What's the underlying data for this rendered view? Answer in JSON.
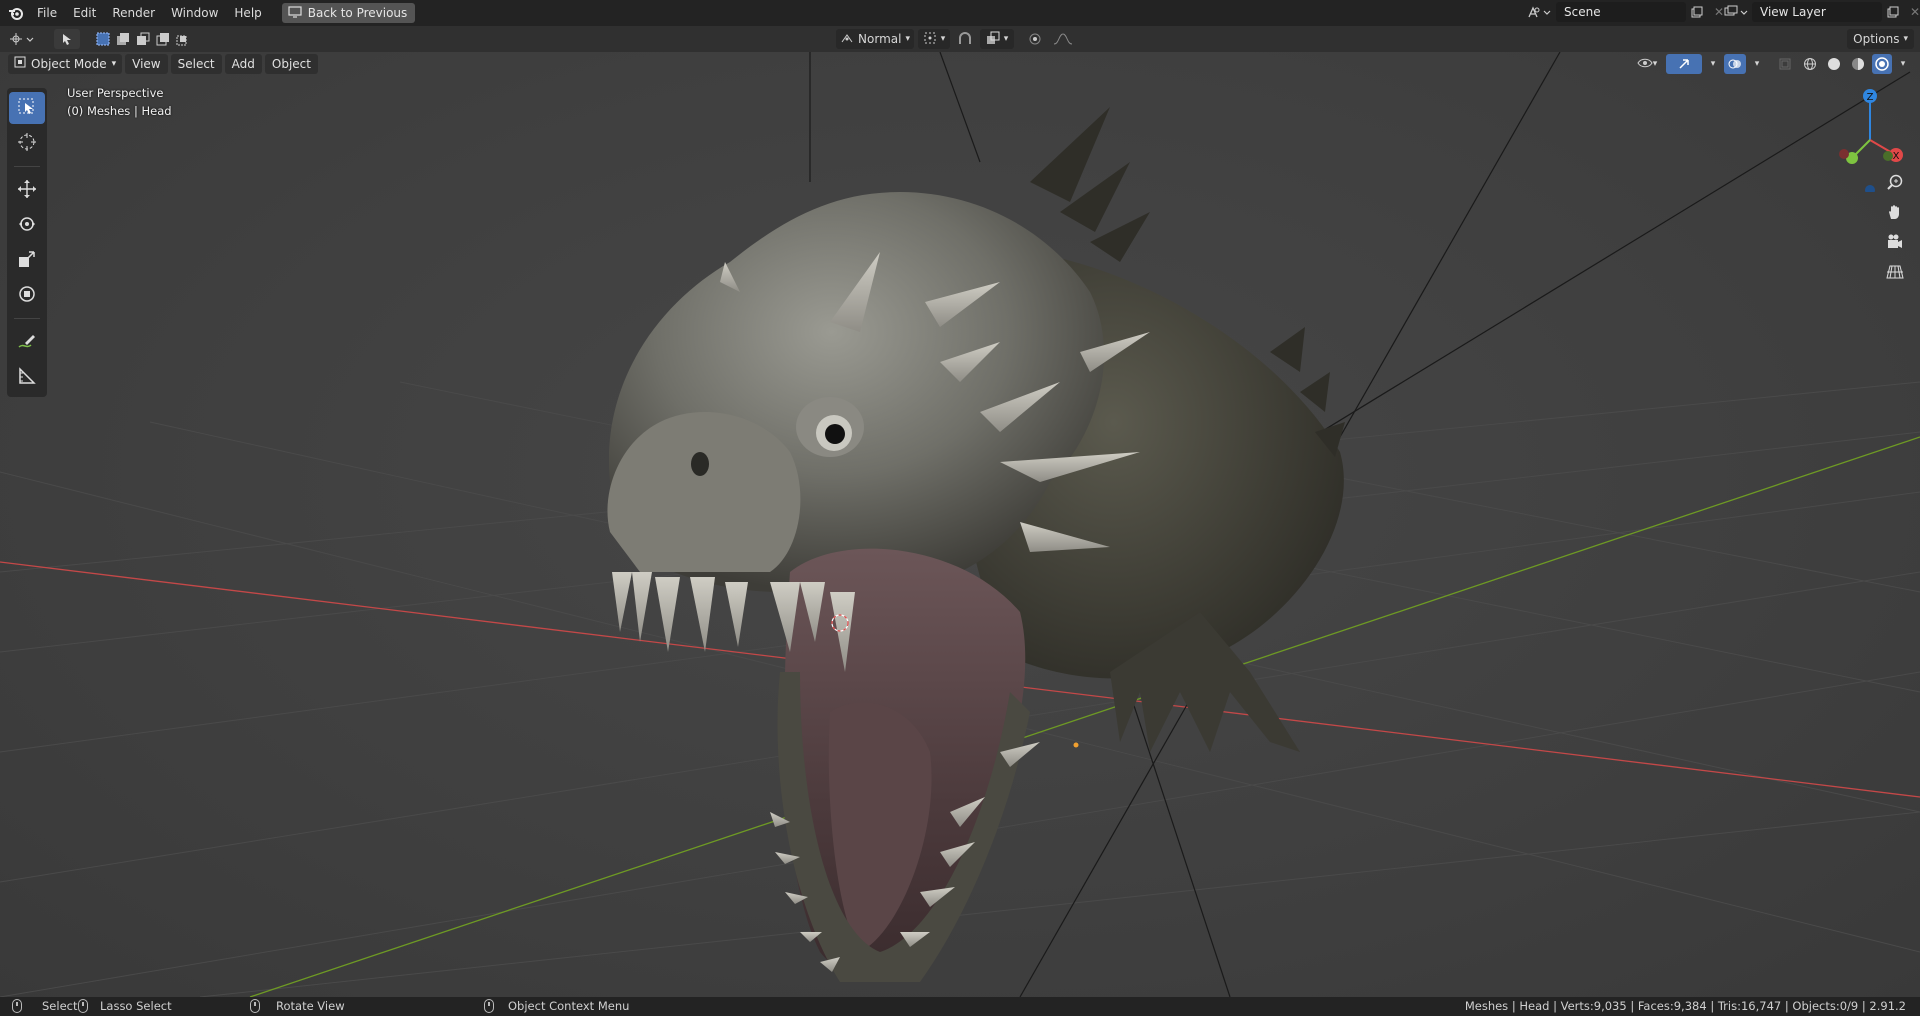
{
  "top_menu": {
    "items": [
      "File",
      "Edit",
      "Render",
      "Window",
      "Help"
    ],
    "back_button": "Back to Previous"
  },
  "scene": {
    "scene_name": "Scene",
    "view_layer": "View Layer"
  },
  "viewport_header": {
    "transform_orientation": "Normal",
    "options_label": "Options"
  },
  "viewport": {
    "mode": "Object Mode",
    "menus": [
      "View",
      "Select",
      "Add",
      "Object"
    ],
    "info_line1": "User Perspective",
    "info_line2": "(0) Meshes | Head",
    "gizmo": {
      "z": "Z",
      "x": "X",
      "y": "Y"
    }
  },
  "toolbar": {
    "icons": [
      "select-box-icon",
      "cursor-icon",
      "move-icon",
      "rotate-icon",
      "scale-icon",
      "transform-icon",
      "annotate-icon",
      "measure-icon"
    ]
  },
  "statusbar": {
    "select": "Select",
    "lasso": "Lasso Select",
    "rotate": "Rotate View",
    "context": "Object Context Menu",
    "stats": "Meshes | Head | Verts:9,035 | Faces:9,384 | Tris:16,747 | Objects:0/9 | 2.91.2"
  },
  "colors": {
    "accent": "#4772b3",
    "axis_x": "#c44848",
    "axis_y": "#6e9a24",
    "gizmo_z": "#2f86e0",
    "gizmo_x": "#e04848",
    "gizmo_y": "#7ec440"
  }
}
